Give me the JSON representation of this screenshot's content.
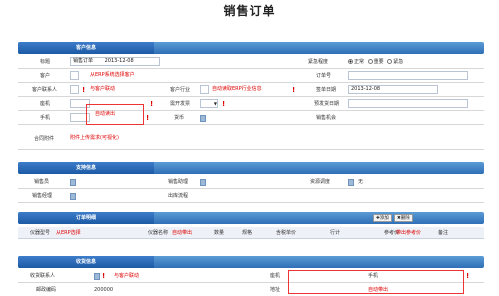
{
  "title": "销售订单",
  "customer_section": {
    "tab": "客户信息",
    "title_label": "标题",
    "title_value": "销售订单",
    "title_date": "2013-12-08",
    "urgency_label": "紧急程度",
    "urgency_options": [
      "正常",
      "重要",
      "紧急"
    ],
    "customer_label": "客户",
    "customer_note": "从ERP系统选择客户",
    "order_no_label": "订单号",
    "contact_label": "客户联系人",
    "contact_note": "与客户联动",
    "industry_label": "客户行业",
    "industry_note": "自动读取ERP行业信息",
    "sign_date_label": "签单日期",
    "sign_date_value": "2013-12-08",
    "phone_label": "座机",
    "auto_fill_note": "自动读出",
    "invoice_label": "需开发票",
    "ship_date_label": "预发货日期",
    "mobile_label": "手机",
    "currency_label": "货币",
    "sales_opp_label": "销售机会",
    "attach_label": "合同附件",
    "attach_note": "附件上传需求(可视化)"
  },
  "support_section": {
    "tab": "支持信息",
    "sales_rep_label": "销售员",
    "sales_asst_label": "销售助理",
    "resource_label": "资源调度",
    "resource_value": "无",
    "sales_mgr_label": "销售经理",
    "ship_method_label": "出库流程"
  },
  "detail_section": {
    "tab": "订单明细",
    "add_button": "添加",
    "delete_button": "删除",
    "columns": [
      "仪器型号",
      "仪器名称",
      "数量",
      "规格",
      "含税单价",
      "行计",
      "参考价",
      "备注"
    ],
    "model_note": "从ERP选择",
    "name_note": "自动带出",
    "ref_note": "带出参考价"
  },
  "receive_section": {
    "tab": "收货信息",
    "receiver_label": "收货联系人",
    "receiver_note": "与客户联动",
    "phone_label": "座机",
    "mobile_label": "手机",
    "postcode_label": "邮政编码",
    "postcode_value": "200000",
    "address_label": "地址",
    "address_note": "自动带出"
  }
}
